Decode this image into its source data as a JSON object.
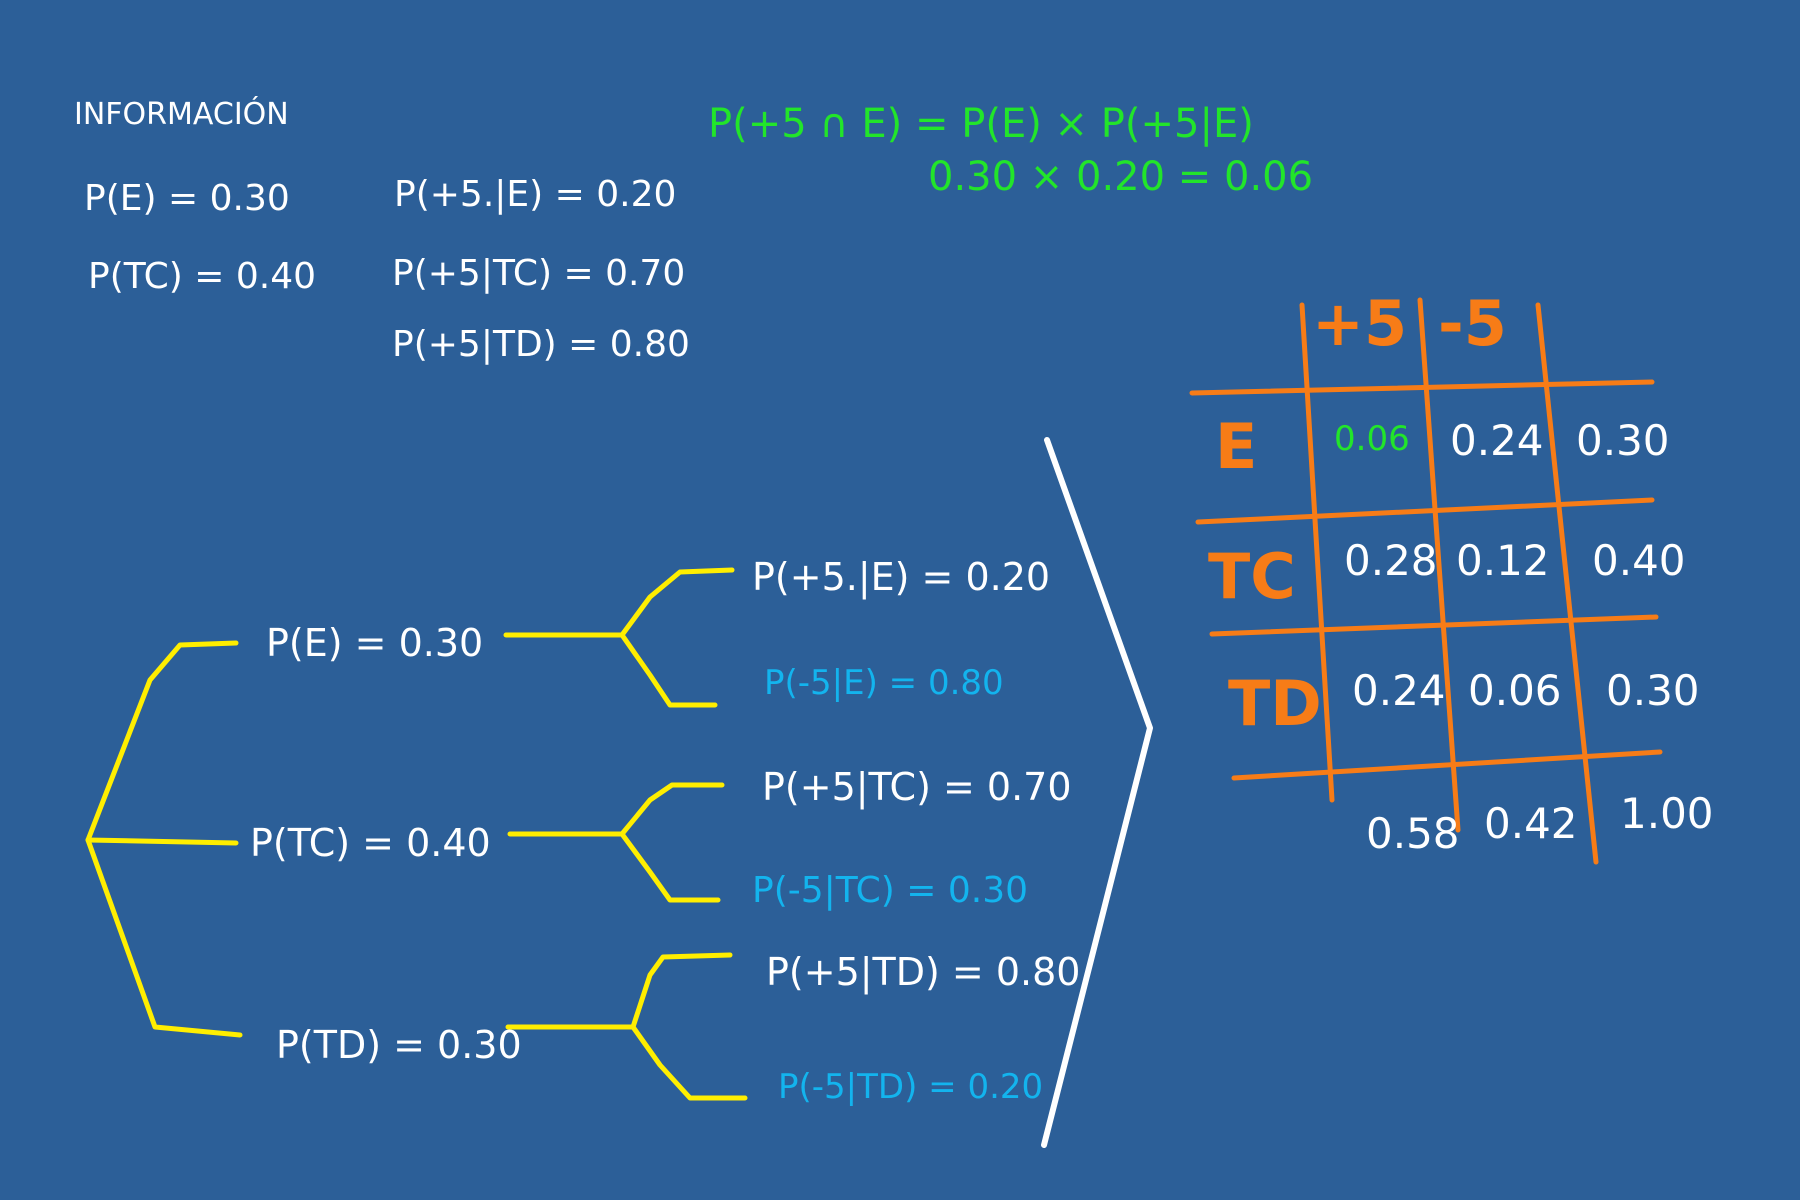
{
  "colors": {
    "background": "#2c5f98",
    "chalk_white": "#ffffff",
    "green": "#22e52a",
    "yellow": "#ffee00",
    "cyan": "#13b4ee",
    "orange": "#f77c17"
  },
  "info": {
    "title": "INFORMACIÓN",
    "left": [
      "P(E) = 0.30",
      "P(TC) = 0.40"
    ],
    "right": [
      "P(+5.|E) = 0.20",
      "P(+5|TC) = 0.70",
      "P(+5|TD) = 0.80"
    ]
  },
  "formula": {
    "line1": "P(+5 ∩ E) = P(E) × P(+5|E)",
    "line2": "0.30 × 0.20 = 0.06"
  },
  "tree": {
    "branches": [
      {
        "label": "P(E) = 0.30",
        "pos": "P(+5.|E) = 0.20",
        "neg": "P(-5|E) = 0.80"
      },
      {
        "label": "P(TC) = 0.40",
        "pos": "P(+5|TC) = 0.70",
        "neg": "P(-5|TC) = 0.30"
      },
      {
        "label": "P(TD) = 0.30",
        "pos": "P(+5|TD) = 0.80",
        "neg": "P(-5|TD) = 0.20"
      }
    ]
  },
  "table": {
    "col_headers": [
      "+5",
      "-5"
    ],
    "rows": [
      {
        "label": "E",
        "cells": [
          "0.06",
          "0.24",
          "0.30"
        ]
      },
      {
        "label": "TC",
        "cells": [
          "0.28",
          "0.12",
          "0.40"
        ]
      },
      {
        "label": "TD",
        "cells": [
          "0.24",
          "0.06",
          "0.30"
        ]
      }
    ],
    "totals": [
      "0.58",
      "0.42",
      "1.00"
    ]
  }
}
